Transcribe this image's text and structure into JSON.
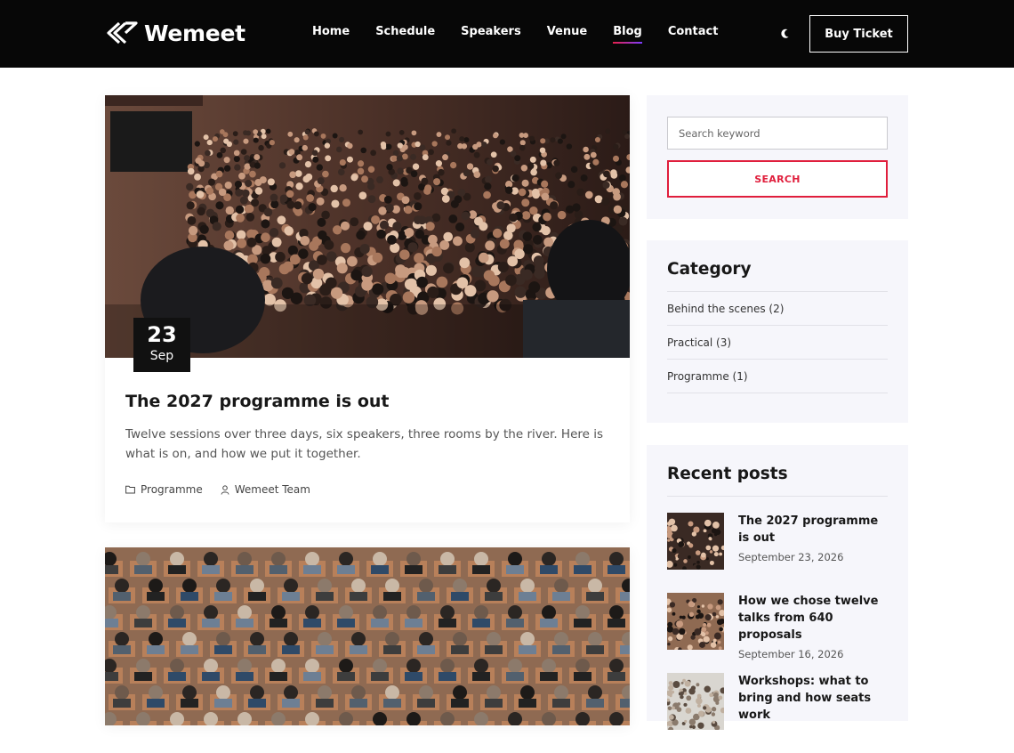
{
  "brand": {
    "name": "Wemeet"
  },
  "nav": {
    "items": [
      {
        "label": "Home"
      },
      {
        "label": "Schedule"
      },
      {
        "label": "Speakers"
      },
      {
        "label": "Venue"
      },
      {
        "label": "Blog",
        "active": true
      },
      {
        "label": "Contact"
      }
    ],
    "buy_label": "Buy Ticket",
    "theme_icon": "moon-icon"
  },
  "posts": [
    {
      "day": "23",
      "month": "Sep",
      "title": "The 2027 programme is out",
      "excerpt": "Twelve sessions over three days, six speakers, three rooms by the river. Here is what is on, and how we put it together.",
      "category": "Programme",
      "author": "Wemeet Team"
    },
    {
      "title": "How we chose twelve talks from 640 proposals"
    }
  ],
  "sidebar": {
    "search": {
      "placeholder": "Search keyword",
      "button": "SEARCH"
    },
    "category": {
      "title": "Category",
      "items": [
        {
          "label": "Behind the scenes (2)"
        },
        {
          "label": "Practical (3)"
        },
        {
          "label": "Programme (1)"
        }
      ]
    },
    "recent": {
      "title": "Recent posts",
      "items": [
        {
          "title": "The 2027 programme is out",
          "date": "September 23, 2026"
        },
        {
          "title": "How we chose twelve talks from 640 proposals",
          "date": "September 16, 2026"
        },
        {
          "title": "Workshops: what to bring and how seats work",
          "date": ""
        }
      ]
    }
  },
  "colors": {
    "accent": "#e01e3c",
    "header_bg": "#070707",
    "sidebar_bg": "#f6f6fb"
  }
}
